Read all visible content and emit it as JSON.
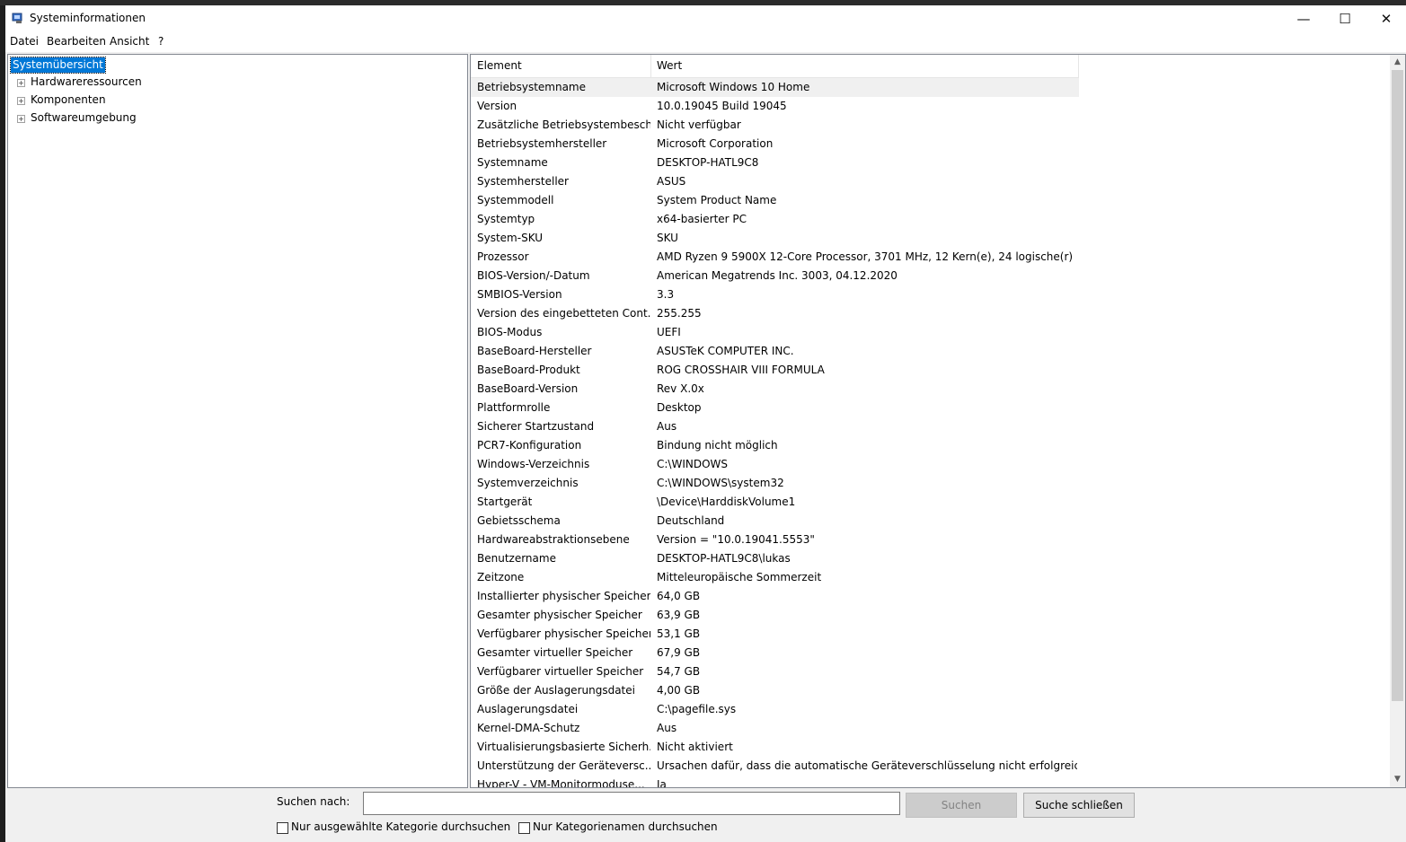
{
  "window": {
    "title": "Systeminformationen",
    "minimize": "—",
    "maximize": "☐",
    "close": "✕"
  },
  "menu": [
    "Datei",
    "Bearbeiten",
    "Ansicht",
    "?"
  ],
  "tree": {
    "root": "Systemübersicht",
    "children": [
      "Hardwareressourcen",
      "Komponenten",
      "Softwareumgebung"
    ]
  },
  "table": {
    "columns": [
      "Element",
      "Wert"
    ],
    "rows": [
      {
        "k": "Betriebsystemname",
        "v": "Microsoft Windows 10 Home"
      },
      {
        "k": "Version",
        "v": "10.0.19045 Build 19045"
      },
      {
        "k": "Zusätzliche Betriebsystembesch...",
        "v": "Nicht verfügbar"
      },
      {
        "k": "Betriebsystemhersteller",
        "v": "Microsoft Corporation"
      },
      {
        "k": "Systemname",
        "v": "DESKTOP-HATL9C8"
      },
      {
        "k": "Systemhersteller",
        "v": "ASUS"
      },
      {
        "k": "Systemmodell",
        "v": "System Product Name"
      },
      {
        "k": "Systemtyp",
        "v": "x64-basierter PC"
      },
      {
        "k": "System-SKU",
        "v": "SKU"
      },
      {
        "k": "Prozessor",
        "v": "AMD Ryzen 9 5900X 12-Core Processor, 3701 MHz, 12 Kern(e), 24 logische(r) ..."
      },
      {
        "k": "BIOS-Version/-Datum",
        "v": "American Megatrends Inc. 3003, 04.12.2020"
      },
      {
        "k": "SMBIOS-Version",
        "v": "3.3"
      },
      {
        "k": "Version des eingebetteten Cont...",
        "v": "255.255"
      },
      {
        "k": "BIOS-Modus",
        "v": "UEFI"
      },
      {
        "k": "BaseBoard-Hersteller",
        "v": "ASUSTeK COMPUTER INC."
      },
      {
        "k": "BaseBoard-Produkt",
        "v": "ROG CROSSHAIR VIII FORMULA"
      },
      {
        "k": "BaseBoard-Version",
        "v": "Rev X.0x"
      },
      {
        "k": "Plattformrolle",
        "v": "Desktop"
      },
      {
        "k": "Sicherer Startzustand",
        "v": "Aus"
      },
      {
        "k": "PCR7-Konfiguration",
        "v": "Bindung nicht möglich"
      },
      {
        "k": "Windows-Verzeichnis",
        "v": "C:\\WINDOWS"
      },
      {
        "k": "Systemverzeichnis",
        "v": "C:\\WINDOWS\\system32"
      },
      {
        "k": "Startgerät",
        "v": "\\Device\\HarddiskVolume1"
      },
      {
        "k": "Gebietsschema",
        "v": "Deutschland"
      },
      {
        "k": "Hardwareabstraktionsebene",
        "v": "Version = \"10.0.19041.5553\""
      },
      {
        "k": "Benutzername",
        "v": "DESKTOP-HATL9C8\\lukas"
      },
      {
        "k": "Zeitzone",
        "v": "Mitteleuropäische Sommerzeit"
      },
      {
        "k": "Installierter physischer Speicher...",
        "v": "64,0 GB"
      },
      {
        "k": "Gesamter physischer Speicher",
        "v": "63,9 GB"
      },
      {
        "k": "Verfügbarer physischer Speicher",
        "v": "53,1 GB"
      },
      {
        "k": "Gesamter virtueller Speicher",
        "v": "67,9 GB"
      },
      {
        "k": "Verfügbarer virtueller Speicher",
        "v": "54,7 GB"
      },
      {
        "k": "Größe der Auslagerungsdatei",
        "v": "4,00 GB"
      },
      {
        "k": "Auslagerungsdatei",
        "v": "C:\\pagefile.sys"
      },
      {
        "k": "Kernel-DMA-Schutz",
        "v": "Aus"
      },
      {
        "k": "Virtualisierungsbasierte Sicherh...",
        "v": "Nicht aktiviert"
      },
      {
        "k": "Unterstützung der Geräteversc...",
        "v": "Ursachen dafür, dass die automatische Geräteverschlüsselung nicht erfolgreic..."
      },
      {
        "k": "Hyper-V - VM-Monitormoduse...",
        "v": "Ja"
      }
    ]
  },
  "search": {
    "label": "Suchen nach:",
    "value": "",
    "search_button": "Suchen",
    "close_button": "Suche schließen",
    "checkbox1": "Nur ausgewählte Kategorie durchsuchen",
    "checkbox2": "Nur Kategorienamen durchsuchen"
  }
}
